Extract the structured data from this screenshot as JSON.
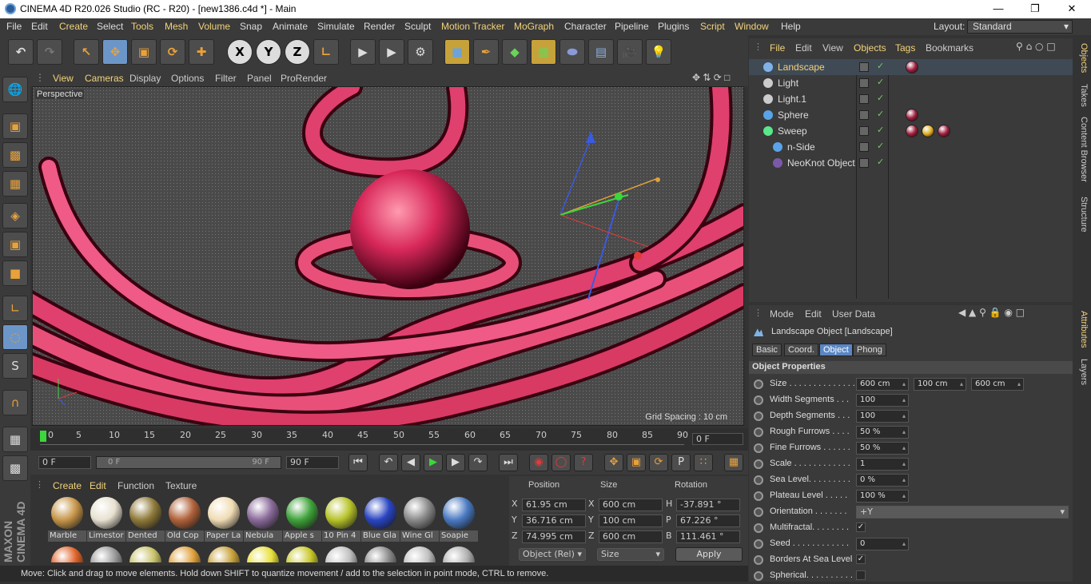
{
  "window": {
    "title": "CINEMA 4D R20.026 Studio (RC - R20) - [new1386.c4d *] - Main"
  },
  "menu": [
    "File",
    "Edit",
    "Create",
    "Select",
    "Tools",
    "Mesh",
    "Volume",
    "Snap",
    "Animate",
    "Simulate",
    "Render",
    "Sculpt",
    "Motion Tracker",
    "MoGraph",
    "Character",
    "Pipeline",
    "Plugins",
    "Script",
    "Window",
    "Help"
  ],
  "layout": {
    "label": "Layout:",
    "value": "Standard"
  },
  "toolbar": {
    "x": "X",
    "y": "Y",
    "z": "Z"
  },
  "viewport": {
    "menu": [
      "View",
      "Cameras",
      "Display",
      "Options",
      "Filter",
      "Panel",
      "ProRender"
    ],
    "camera": "Perspective",
    "grid_spacing": "Grid Spacing : 10 cm"
  },
  "timeline": {
    "ticks": [
      "0",
      "5",
      "10",
      "15",
      "20",
      "25",
      "30",
      "35",
      "40",
      "45",
      "50",
      "55",
      "60",
      "65",
      "70",
      "75",
      "80",
      "85",
      "90"
    ],
    "current_frame": "0 F",
    "start": "0 F",
    "range_start": "0 F",
    "range_end": "90 F",
    "end": "90 F"
  },
  "materials": {
    "menu": [
      "Create",
      "Edit",
      "Function",
      "Texture"
    ],
    "items": [
      {
        "label": "Marble",
        "color": "#c7964a"
      },
      {
        "label": "Limestor",
        "color": "#e7e1d0"
      },
      {
        "label": "Dented",
        "color": "#8f7a3a"
      },
      {
        "label": "Old Cop",
        "color": "#b0623a"
      },
      {
        "label": "Paper La",
        "color": "#f0dcb4"
      },
      {
        "label": "Nebula",
        "color": "#8a6a9a"
      },
      {
        "label": "Apple s",
        "color": "#3fa33a"
      },
      {
        "label": "10 Pin 4",
        "color": "#b7c32a"
      },
      {
        "label": "Blue Gla",
        "color": "#2a45c2"
      },
      {
        "label": "Wine Gl",
        "color": "#8a8a8a"
      },
      {
        "label": "Soapie",
        "color": "#4a7ac2"
      }
    ],
    "row2_colors": [
      "#e0632a",
      "#9a9a9a",
      "#c8c26a",
      "#e0a13b",
      "#c8a13a",
      "#e8e03a",
      "#c8c82a",
      "#c0c0c0",
      "#8a8a8a",
      "#c0c0c0",
      "#b0b0b0"
    ]
  },
  "coordinates": {
    "headers": [
      "Position",
      "Size",
      "Rotation"
    ],
    "rows": [
      {
        "axis": "X",
        "pos": "61.95 cm",
        "size_axis": "X",
        "size": "600 cm",
        "rot_axis": "H",
        "rot": "-37.891 °"
      },
      {
        "axis": "Y",
        "pos": "36.716 cm",
        "size_axis": "Y",
        "size": "100 cm",
        "rot_axis": "P",
        "rot": "67.226 °"
      },
      {
        "axis": "Z",
        "pos": "74.995 cm",
        "size_axis": "Z",
        "size": "600 cm",
        "rot_axis": "B",
        "rot": "111.461 °"
      }
    ],
    "mode": "Object (Rel)",
    "size_mode": "Size",
    "apply": "Apply"
  },
  "status": "Move: Click and drag to move elements. Hold down SHIFT to quantize movement / add to the selection in point mode, CTRL to remove.",
  "objects": {
    "menu": [
      "File",
      "Edit",
      "View",
      "Objects",
      "Tags",
      "Bookmarks"
    ],
    "items": [
      {
        "name": "Landscape",
        "color": "#7fb3e8",
        "selected": true
      },
      {
        "name": "Light",
        "color": "#cccccc"
      },
      {
        "name": "Light.1",
        "color": "#cccccc"
      },
      {
        "name": "Sphere",
        "color": "#5aa3e8"
      },
      {
        "name": "Sweep",
        "color": "#5ae88a"
      },
      {
        "name": "n-Side",
        "color": "#5aa3e8"
      },
      {
        "name": "NeoKnot Object",
        "color": "#7a5aa8"
      }
    ]
  },
  "attributes": {
    "menu": [
      "Mode",
      "Edit",
      "User Data"
    ],
    "header": "Landscape Object [Landscape]",
    "tabs": [
      "Basic",
      "Coord.",
      "Object",
      "Phong"
    ],
    "section": "Object Properties",
    "props": [
      {
        "label": "Size . . . . . . . . . . . . . . .",
        "values": [
          "600 cm",
          "100 cm",
          "600 cm"
        ]
      },
      {
        "label": "Width Segments . . .",
        "values": [
          "100"
        ]
      },
      {
        "label": "Depth Segments . . .",
        "values": [
          "100"
        ]
      },
      {
        "label": "Rough Furrows . . . .",
        "values": [
          "50 %"
        ]
      },
      {
        "label": "Fine Furrows . . . . . .",
        "values": [
          "50 %"
        ]
      },
      {
        "label": "Scale . . . . . . . . . . . .",
        "values": [
          "1"
        ]
      },
      {
        "label": "Sea Level. . . . . . . . .",
        "values": [
          "0 %"
        ]
      },
      {
        "label": "Plateau Level . . . . .",
        "values": [
          "100 %"
        ]
      },
      {
        "label": "Orientation . . . . . . .",
        "values": [
          "+Y"
        ]
      },
      {
        "label": "Multifractal. . . . . . . .",
        "check": "✓"
      },
      {
        "label": "Seed . . . . . . . . . . . .",
        "values": [
          "0"
        ]
      },
      {
        "label": "Borders At Sea Level",
        "check": "✓"
      },
      {
        "label": "Spherical. . . . . . . . . .",
        "check": ""
      }
    ]
  },
  "side_tabs": [
    "Objects",
    "Takes",
    "Content Browser",
    "Structure",
    "Attributes",
    "Layers"
  ]
}
